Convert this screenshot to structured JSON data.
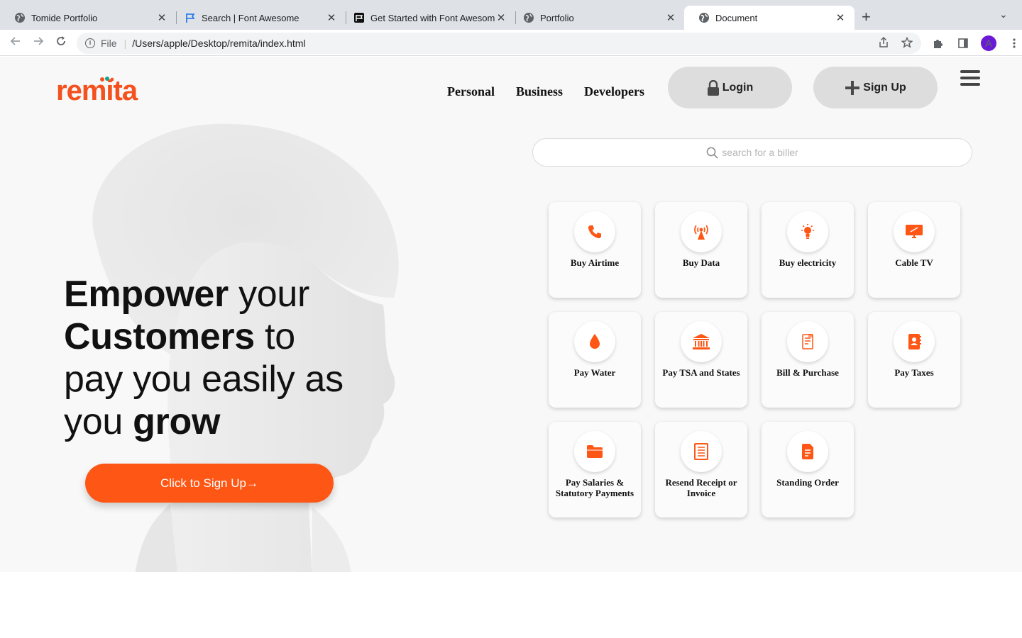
{
  "browser": {
    "tabs": [
      {
        "title": "Tomide Portfolio",
        "icon": "globe-icon"
      },
      {
        "title": "Search | Font Awesome",
        "icon": "flag-icon"
      },
      {
        "title": "Get Started with Font Awesome",
        "icon": "flag-square-icon"
      },
      {
        "title": "Portfolio",
        "icon": "globe-icon"
      },
      {
        "title": "Document",
        "icon": "globe-icon"
      }
    ],
    "active_tab": 4,
    "url_scheme": "File",
    "url_path": "/Users/apple/Desktop/remita/index.html",
    "avatar_letter": "A"
  },
  "site": {
    "logo": "remita",
    "nav": [
      "Personal",
      "Business",
      "Developers"
    ],
    "login_label": "Login",
    "signup_label": "Sign Up",
    "search_placeholder": "search for a biller",
    "headline": {
      "w1": "Empower",
      "w2": " your",
      "w3": "Customers",
      "w4": " to",
      "w5": "pay you easily as",
      "w6": "you ",
      "w7": "grow"
    },
    "cta_label": "Click to Sign Up→",
    "services": [
      {
        "label": "Buy Airtime",
        "icon": "phone-icon"
      },
      {
        "label": "Buy Data",
        "icon": "broadcast-tower-icon"
      },
      {
        "label": "Buy electricity",
        "icon": "lightbulb-icon"
      },
      {
        "label": "Cable TV",
        "icon": "tv-icon"
      },
      {
        "label": "Pay Water",
        "icon": "water-drop-icon"
      },
      {
        "label": "Pay TSA and States",
        "icon": "landmark-icon"
      },
      {
        "label": "Bill & Purchase",
        "icon": "receipt-icon"
      },
      {
        "label": "Pay Taxes",
        "icon": "address-book-icon"
      },
      {
        "label": "Pay Salaries & Statutory Payments",
        "icon": "folder-icon"
      },
      {
        "label": "Resend Receipt or Invoice",
        "icon": "list-document-icon"
      },
      {
        "label": "Standing Order",
        "icon": "file-lines-icon"
      }
    ],
    "accent": "#fe5614"
  }
}
